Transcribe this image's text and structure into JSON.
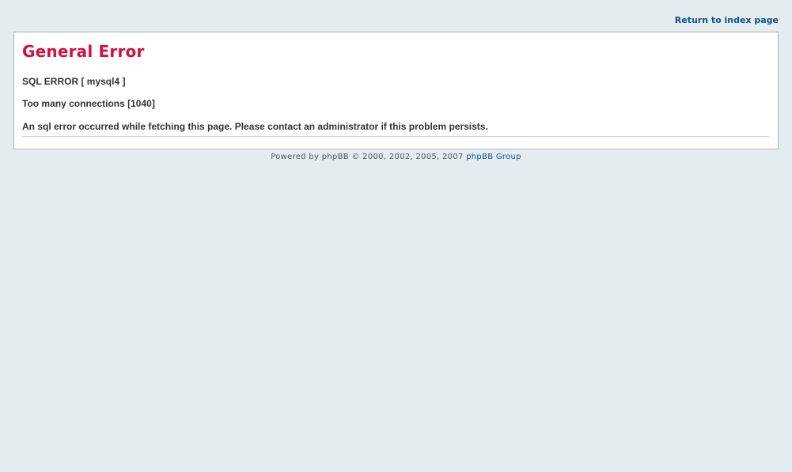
{
  "header": {
    "return_link": "Return to index page"
  },
  "error": {
    "title": "General Error",
    "line1": "SQL ERROR [ mysql4 ]",
    "line2": "Too many connections [1040]",
    "line3": "An sql error occurred while fetching this page. Please contact an administrator if this problem persists."
  },
  "footer": {
    "text": "Powered by phpBB © 2000, 2002, 2005, 2007 ",
    "link": "phpBB Group"
  },
  "colors": {
    "page_background": "#e4ecef",
    "panel_background": "#ffffff",
    "title": "#d31141",
    "link": "#105289"
  }
}
